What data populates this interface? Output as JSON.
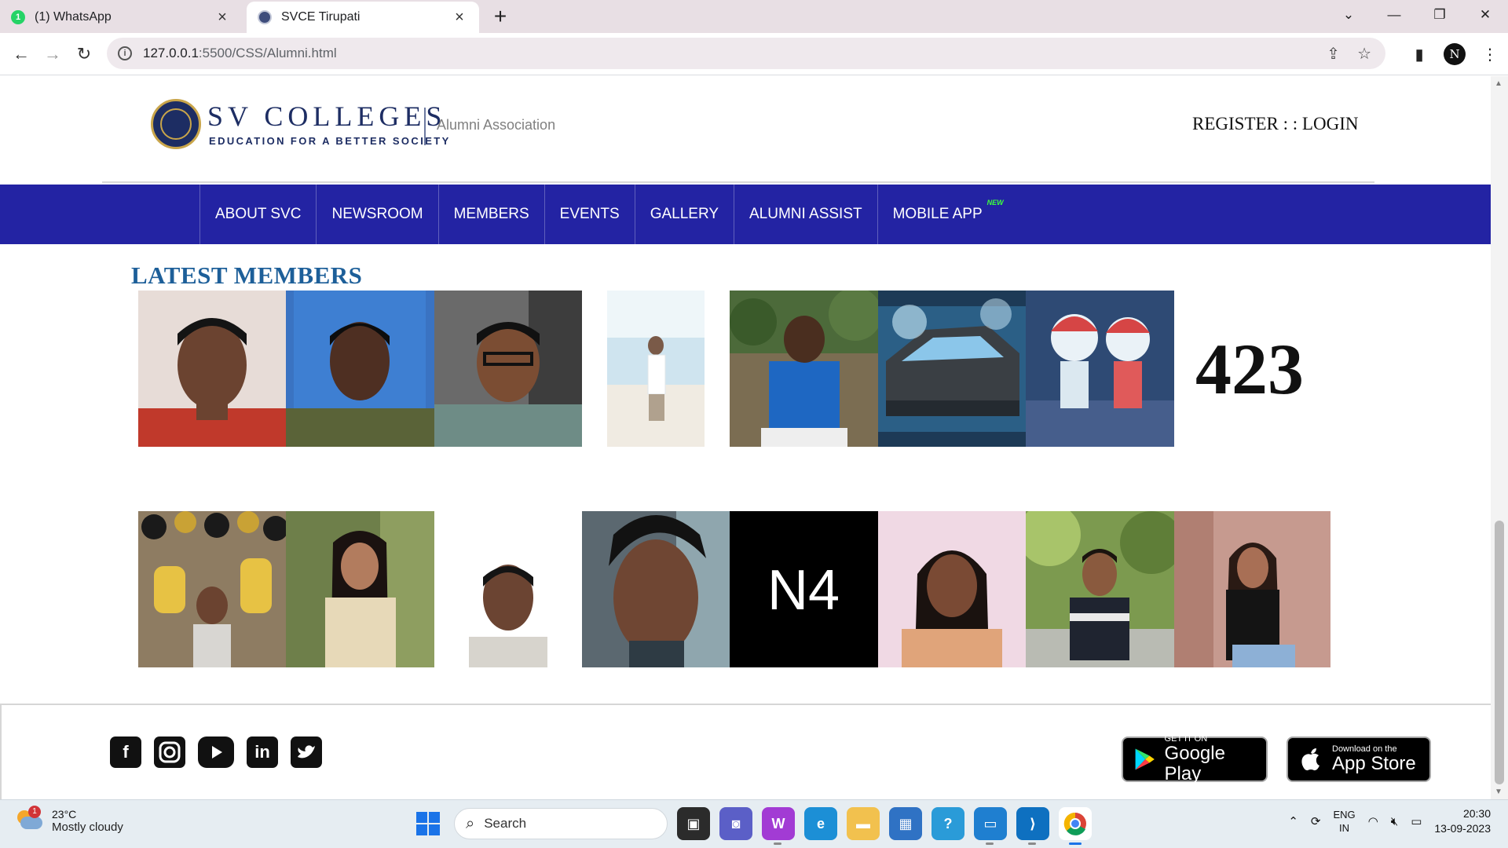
{
  "browser": {
    "tabs": [
      {
        "title": "(1) WhatsApp",
        "badge": "1",
        "icon": "whatsapp-icon",
        "active": false
      },
      {
        "title": "SVCE Tirupati",
        "icon": "svce-favicon",
        "active": true
      }
    ],
    "url_host": "127.0.0.1",
    "url_path": ":5500/CSS/Alumni.html"
  },
  "header": {
    "logo_name": "SV COLLEGES",
    "logo_tagline": "EDUCATION FOR A BETTER SOCIETY",
    "association": "Alumni Association",
    "auth_links": "REGISTER : : LOGIN"
  },
  "nav": {
    "items": [
      "ABOUT SVC",
      "NEWSROOM",
      "MEMBERS",
      "EVENTS",
      "GALLERY",
      "ALUMNI ASSIST",
      "MOBILE APP"
    ],
    "new_flag": "NEW"
  },
  "members": {
    "title": "LATEST MEMBERS",
    "count_image_text": "423",
    "n4_tile_text": "N4"
  },
  "footer": {
    "social_icons": [
      "facebook-icon",
      "instagram-icon",
      "youtube-icon",
      "linkedin-icon",
      "twitter-icon"
    ],
    "google_play": {
      "small": "GET IT ON",
      "big": "Google Play"
    },
    "app_store": {
      "small": "Download on the",
      "big": "App Store"
    }
  },
  "taskbar": {
    "weather_badge": "1",
    "temperature": "23°C",
    "condition": "Mostly cloudy",
    "search_placeholder": "Search",
    "lang_line1": "ENG",
    "lang_line2": "IN",
    "time": "20:30",
    "date": "13-09-2023"
  },
  "colors": {
    "nav_bg": "#2323a3",
    "title_blue": "#1d5f99",
    "brand_navy": "#1d2d63"
  }
}
